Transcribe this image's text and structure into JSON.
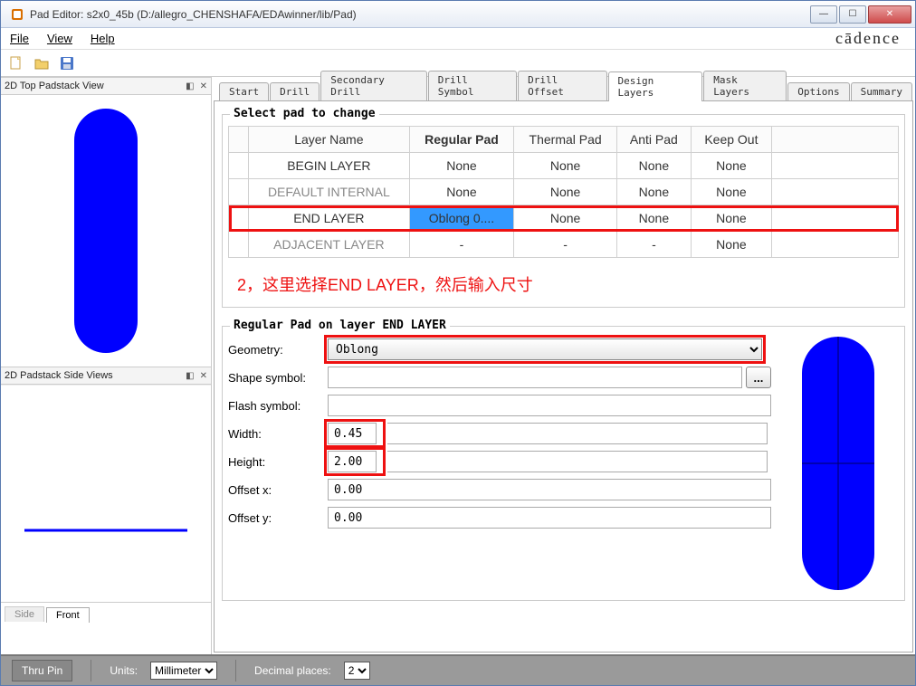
{
  "title": "Pad Editor: s2x0_45b  (D:/allegro_CHENSHAFA/EDAwinner/lib/Pad)",
  "menu": {
    "file": "File",
    "view": "View",
    "help": "Help"
  },
  "brand": "cādence",
  "panels": {
    "top": "2D Top Padstack View",
    "side": "2D Padstack Side Views",
    "side_tab": "Side",
    "front_tab": "Front"
  },
  "tabs": [
    "Start",
    "Drill",
    "Secondary Drill",
    "Drill Symbol",
    "Drill Offset",
    "Design Layers",
    "Mask Layers",
    "Options",
    "Summary"
  ],
  "active_tab_index": 5,
  "group1_label": "Select pad to change",
  "columns": [
    "Layer Name",
    "Regular Pad",
    "Thermal Pad",
    "Anti Pad",
    "Keep Out"
  ],
  "rows": [
    {
      "name": "BEGIN LAYER",
      "reg": "None",
      "th": "None",
      "anti": "None",
      "ko": "None",
      "gray": false
    },
    {
      "name": "DEFAULT INTERNAL",
      "reg": "None",
      "th": "None",
      "anti": "None",
      "ko": "None",
      "gray": true
    },
    {
      "name": "END LAYER",
      "reg": "Oblong 0....",
      "th": "None",
      "anti": "None",
      "ko": "None",
      "gray": false,
      "selected": true
    },
    {
      "name": "ADJACENT LAYER",
      "reg": "-",
      "th": "-",
      "anti": "-",
      "ko": "None",
      "gray": true
    }
  ],
  "annotation": "2，这里选择END LAYER，然后输入尺寸",
  "group2_label": "Regular Pad on layer END LAYER",
  "form": {
    "geometry_label": "Geometry:",
    "geometry_value": "Oblong",
    "shape_label": "Shape symbol:",
    "shape_value": "",
    "flash_label": "Flash symbol:",
    "flash_value": "",
    "width_label": "Width:",
    "width_value": "0.45",
    "height_label": "Height:",
    "height_value": "2.00",
    "offx_label": "Offset x:",
    "offx_value": "0.00",
    "offy_label": "Offset y:",
    "offy_value": "0.00",
    "browse": "..."
  },
  "status": {
    "thrupin": "Thru Pin",
    "units_label": "Units:",
    "units_value": "Millimeter",
    "dec_label": "Decimal places:",
    "dec_value": "2"
  }
}
